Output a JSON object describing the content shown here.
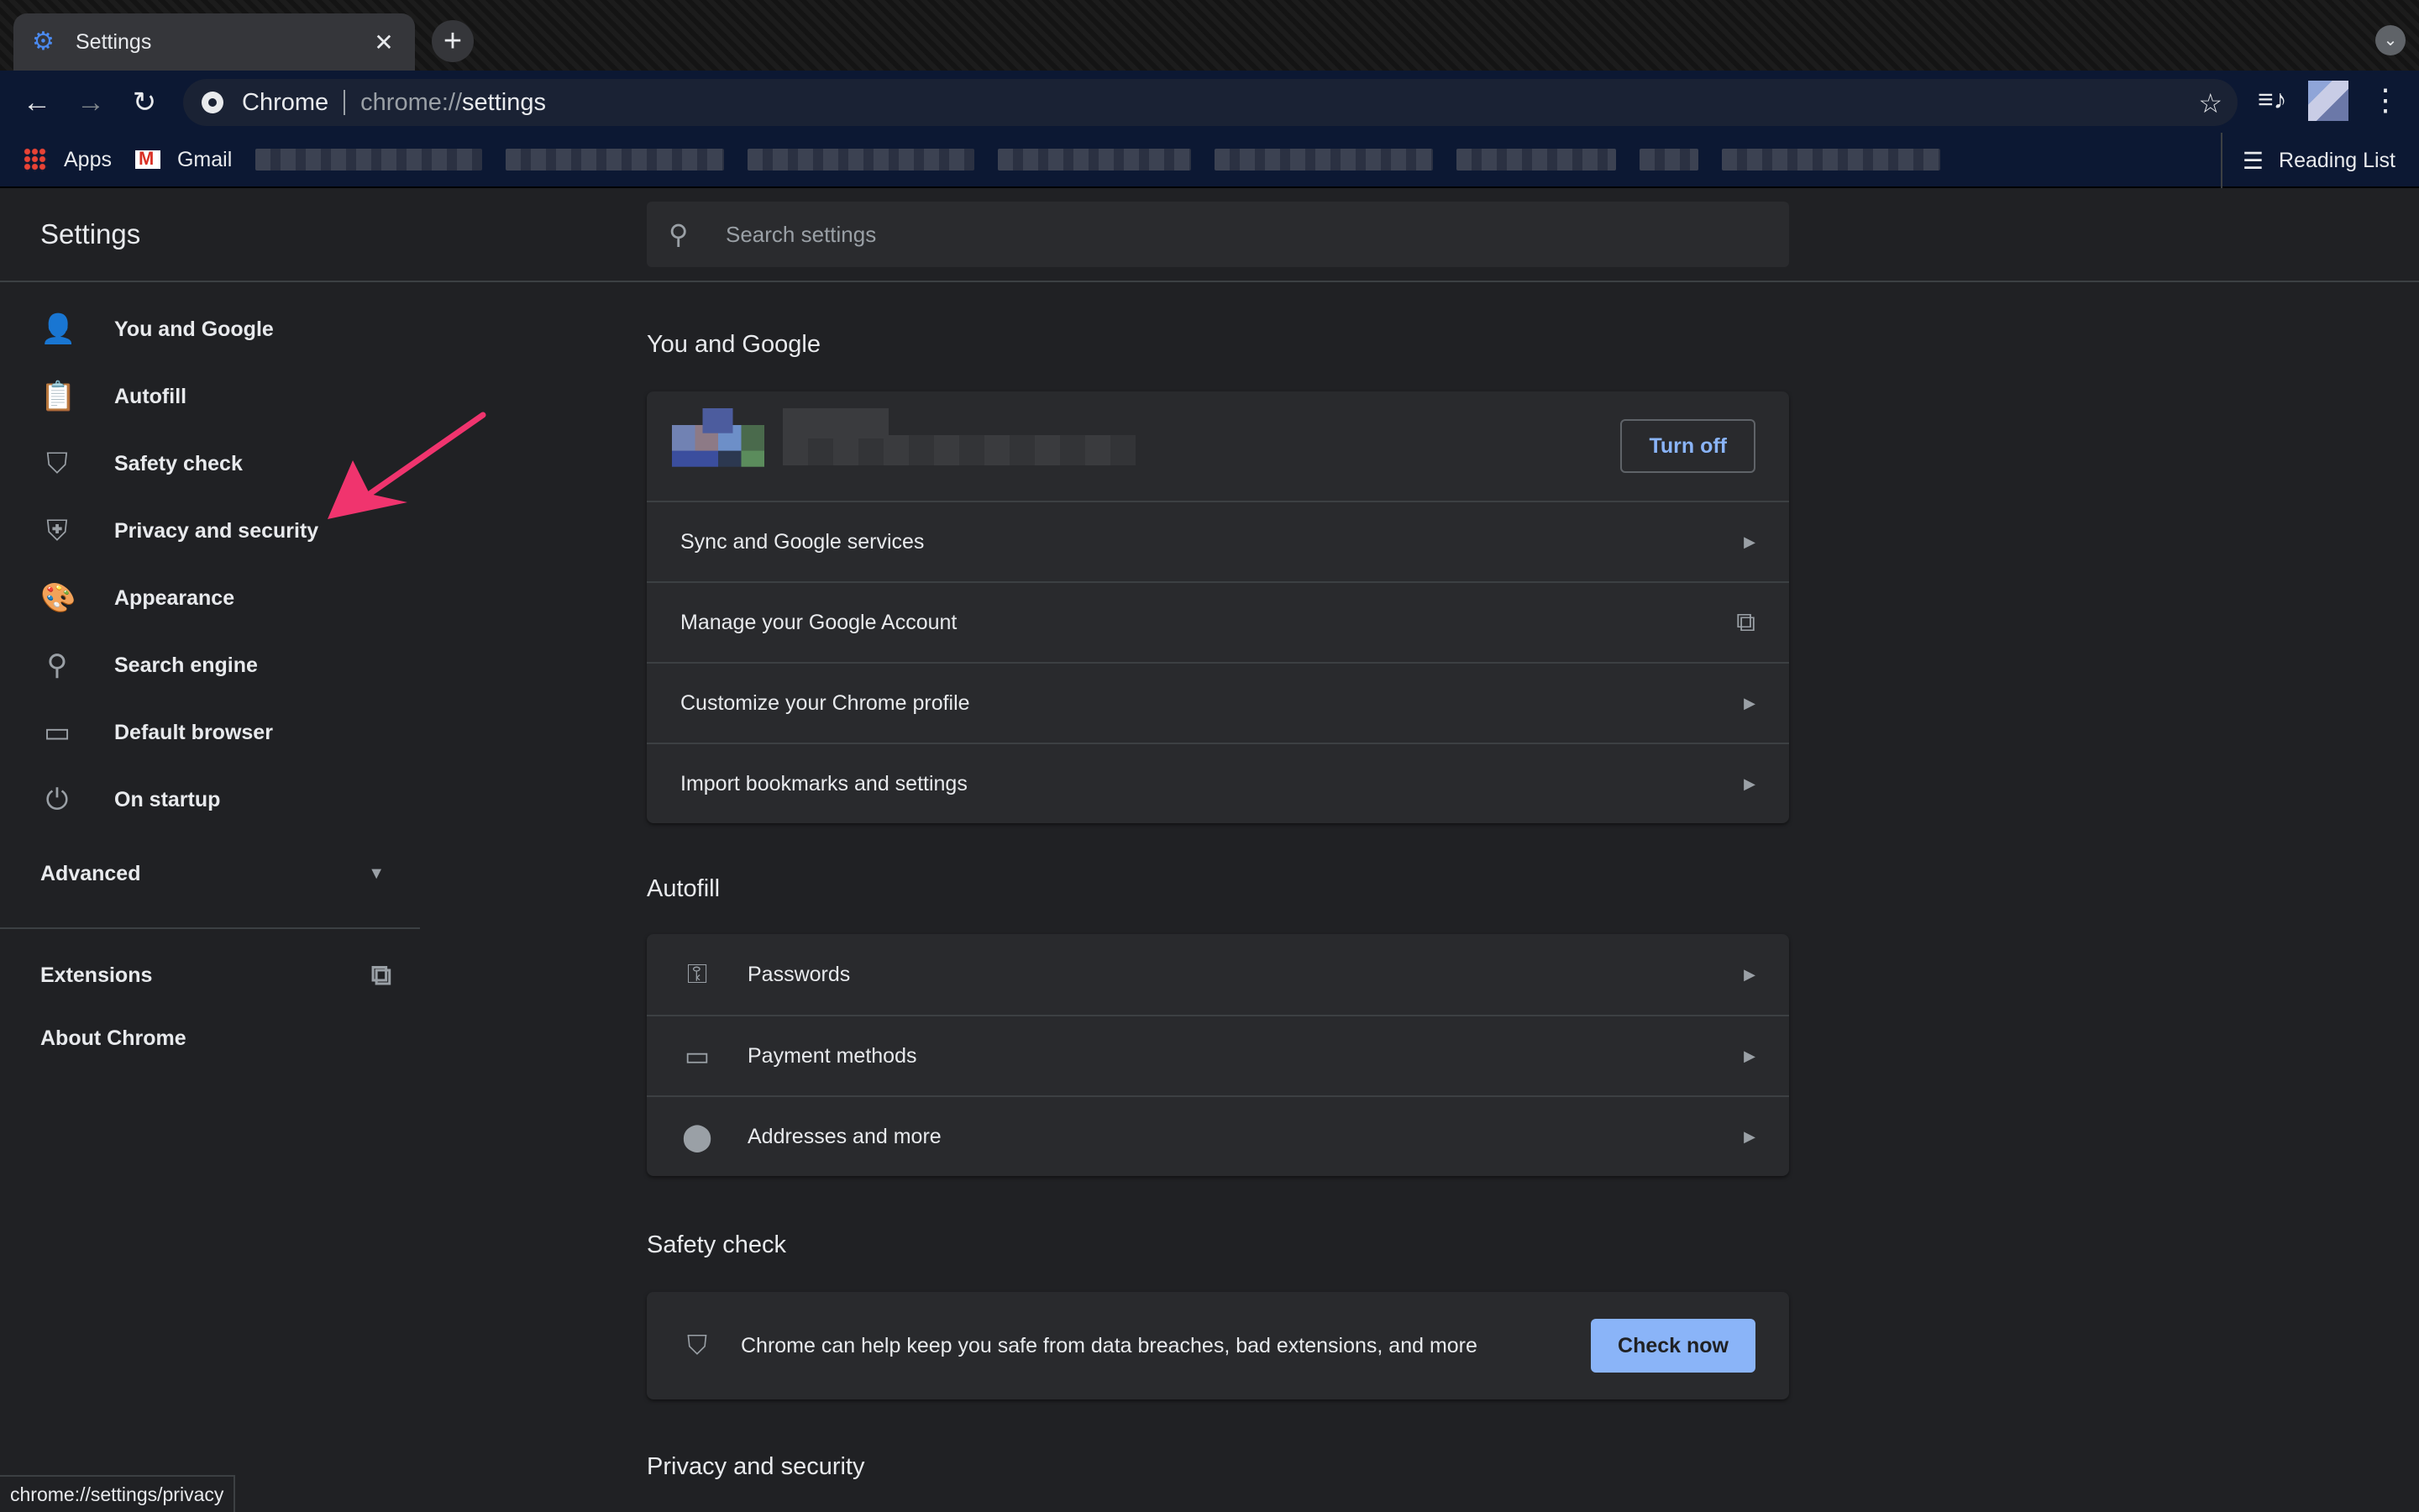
{
  "browser": {
    "tab": {
      "title": "Settings",
      "favicon": "gear-icon"
    },
    "omnibox": {
      "chip": "Chrome",
      "url_scheme": "chrome://",
      "url_path": "settings"
    },
    "bookmarks": {
      "apps": "Apps",
      "gmail": "Gmail",
      "reading_list": "Reading List"
    },
    "status_url": "chrome://settings/privacy"
  },
  "settings": {
    "title": "Settings",
    "search_placeholder": "Search settings",
    "sidebar": {
      "items": [
        {
          "label": "You and Google",
          "icon": "person-icon"
        },
        {
          "label": "Autofill",
          "icon": "clipboard-icon"
        },
        {
          "label": "Safety check",
          "icon": "shield-check-icon"
        },
        {
          "label": "Privacy and security",
          "icon": "shield-icon"
        },
        {
          "label": "Appearance",
          "icon": "palette-icon"
        },
        {
          "label": "Search engine",
          "icon": "search-icon"
        },
        {
          "label": "Default browser",
          "icon": "browser-icon"
        },
        {
          "label": "On startup",
          "icon": "power-icon"
        }
      ],
      "advanced": "Advanced",
      "extensions": "Extensions",
      "about": "About Chrome"
    },
    "you_and_google": {
      "title": "You and Google",
      "turn_off": "Turn off",
      "rows": [
        "Sync and Google services",
        "Manage your Google Account",
        "Customize your Chrome profile",
        "Import bookmarks and settings"
      ]
    },
    "autofill": {
      "title": "Autofill",
      "rows": [
        "Passwords",
        "Payment methods",
        "Addresses and more"
      ]
    },
    "safety_check": {
      "title": "Safety check",
      "text": "Chrome can help keep you safe from data breaches, bad extensions, and more",
      "button": "Check now"
    },
    "privacy": {
      "title": "Privacy and security"
    }
  },
  "colors": {
    "background": "#202124",
    "card": "#292a2d",
    "accent": "#8ab4f8",
    "annotation_arrow": "#f0346e"
  }
}
